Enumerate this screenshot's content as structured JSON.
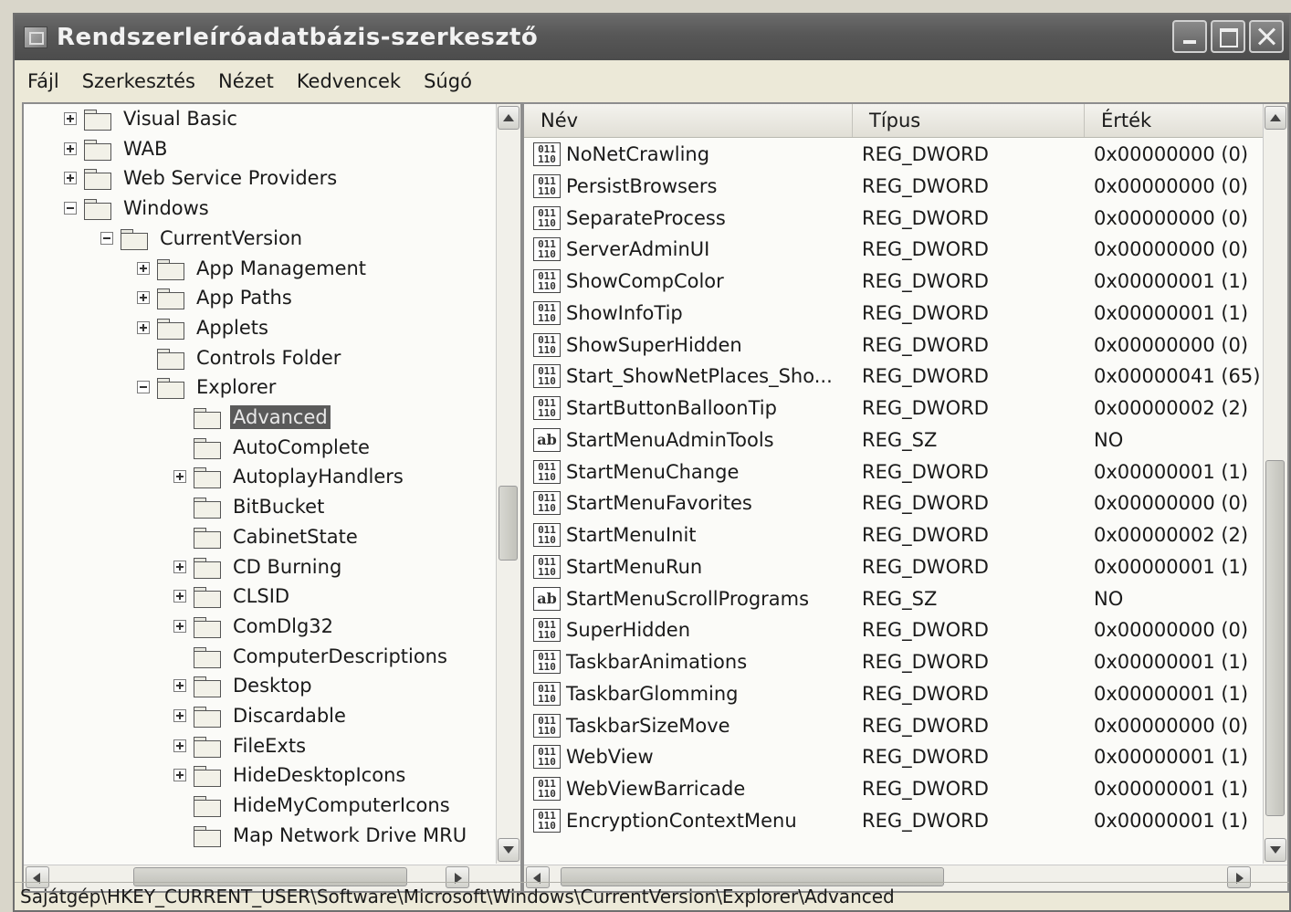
{
  "window": {
    "title": "Rendszerleíróadatbázis-szerkesztő"
  },
  "menu": [
    "Fájl",
    "Szerkesztés",
    "Nézet",
    "Kedvencek",
    "Súgó"
  ],
  "tree": [
    {
      "label": "Visual Basic",
      "depth": 0,
      "expander": "plus"
    },
    {
      "label": "WAB",
      "depth": 0,
      "expander": "plus"
    },
    {
      "label": "Web Service Providers",
      "depth": 0,
      "expander": "plus"
    },
    {
      "label": "Windows",
      "depth": 0,
      "expander": "minus"
    },
    {
      "label": "CurrentVersion",
      "depth": 1,
      "expander": "minus"
    },
    {
      "label": "App Management",
      "depth": 2,
      "expander": "plus"
    },
    {
      "label": "App Paths",
      "depth": 2,
      "expander": "plus"
    },
    {
      "label": "Applets",
      "depth": 2,
      "expander": "plus"
    },
    {
      "label": "Controls Folder",
      "depth": 2,
      "expander": "none"
    },
    {
      "label": "Explorer",
      "depth": 2,
      "expander": "minus"
    },
    {
      "label": "Advanced",
      "depth": 3,
      "expander": "none",
      "selected": true
    },
    {
      "label": "AutoComplete",
      "depth": 3,
      "expander": "none"
    },
    {
      "label": "AutoplayHandlers",
      "depth": 3,
      "expander": "plus"
    },
    {
      "label": "BitBucket",
      "depth": 3,
      "expander": "none"
    },
    {
      "label": "CabinetState",
      "depth": 3,
      "expander": "none"
    },
    {
      "label": "CD Burning",
      "depth": 3,
      "expander": "plus"
    },
    {
      "label": "CLSID",
      "depth": 3,
      "expander": "plus"
    },
    {
      "label": "ComDlg32",
      "depth": 3,
      "expander": "plus"
    },
    {
      "label": "ComputerDescriptions",
      "depth": 3,
      "expander": "none"
    },
    {
      "label": "Desktop",
      "depth": 3,
      "expander": "plus"
    },
    {
      "label": "Discardable",
      "depth": 3,
      "expander": "plus"
    },
    {
      "label": "FileExts",
      "depth": 3,
      "expander": "plus"
    },
    {
      "label": "HideDesktopIcons",
      "depth": 3,
      "expander": "plus"
    },
    {
      "label": "HideMyComputerIcons",
      "depth": 3,
      "expander": "none"
    },
    {
      "label": "Map Network Drive MRU",
      "depth": 3,
      "expander": "none"
    }
  ],
  "columns": {
    "name": "Név",
    "type": "Típus",
    "value": "Érték"
  },
  "values": [
    {
      "name": "NoNetCrawling",
      "type": "REG_DWORD",
      "value": "0x00000000 (0)",
      "kind": "dword"
    },
    {
      "name": "PersistBrowsers",
      "type": "REG_DWORD",
      "value": "0x00000000 (0)",
      "kind": "dword"
    },
    {
      "name": "SeparateProcess",
      "type": "REG_DWORD",
      "value": "0x00000000 (0)",
      "kind": "dword"
    },
    {
      "name": "ServerAdminUI",
      "type": "REG_DWORD",
      "value": "0x00000000 (0)",
      "kind": "dword"
    },
    {
      "name": "ShowCompColor",
      "type": "REG_DWORD",
      "value": "0x00000001 (1)",
      "kind": "dword"
    },
    {
      "name": "ShowInfoTip",
      "type": "REG_DWORD",
      "value": "0x00000001 (1)",
      "kind": "dword"
    },
    {
      "name": "ShowSuperHidden",
      "type": "REG_DWORD",
      "value": "0x00000000 (0)",
      "kind": "dword"
    },
    {
      "name": "Start_ShowNetPlaces_Sho...",
      "type": "REG_DWORD",
      "value": "0x00000041 (65)",
      "kind": "dword"
    },
    {
      "name": "StartButtonBalloonTip",
      "type": "REG_DWORD",
      "value": "0x00000002 (2)",
      "kind": "dword"
    },
    {
      "name": "StartMenuAdminTools",
      "type": "REG_SZ",
      "value": "NO",
      "kind": "sz"
    },
    {
      "name": "StartMenuChange",
      "type": "REG_DWORD",
      "value": "0x00000001 (1)",
      "kind": "dword"
    },
    {
      "name": "StartMenuFavorites",
      "type": "REG_DWORD",
      "value": "0x00000000 (0)",
      "kind": "dword"
    },
    {
      "name": "StartMenuInit",
      "type": "REG_DWORD",
      "value": "0x00000002 (2)",
      "kind": "dword"
    },
    {
      "name": "StartMenuRun",
      "type": "REG_DWORD",
      "value": "0x00000001 (1)",
      "kind": "dword"
    },
    {
      "name": "StartMenuScrollPrograms",
      "type": "REG_SZ",
      "value": "NO",
      "kind": "sz"
    },
    {
      "name": "SuperHidden",
      "type": "REG_DWORD",
      "value": "0x00000000 (0)",
      "kind": "dword"
    },
    {
      "name": "TaskbarAnimations",
      "type": "REG_DWORD",
      "value": "0x00000001 (1)",
      "kind": "dword"
    },
    {
      "name": "TaskbarGlomming",
      "type": "REG_DWORD",
      "value": "0x00000001 (1)",
      "kind": "dword"
    },
    {
      "name": "TaskbarSizeMove",
      "type": "REG_DWORD",
      "value": "0x00000000 (0)",
      "kind": "dword"
    },
    {
      "name": "WebView",
      "type": "REG_DWORD",
      "value": "0x00000001 (1)",
      "kind": "dword"
    },
    {
      "name": "WebViewBarricade",
      "type": "REG_DWORD",
      "value": "0x00000001 (1)",
      "kind": "dword"
    },
    {
      "name": "EncryptionContextMenu",
      "type": "REG_DWORD",
      "value": "0x00000001 (1)",
      "kind": "dword",
      "highlighted": true
    }
  ],
  "icons": {
    "dword_text": "011\n110",
    "sz_text": "ab"
  },
  "status_path": "Sajátgép\\HKEY_CURRENT_USER\\Software\\Microsoft\\Windows\\CurrentVersion\\Explorer\\Advanced"
}
